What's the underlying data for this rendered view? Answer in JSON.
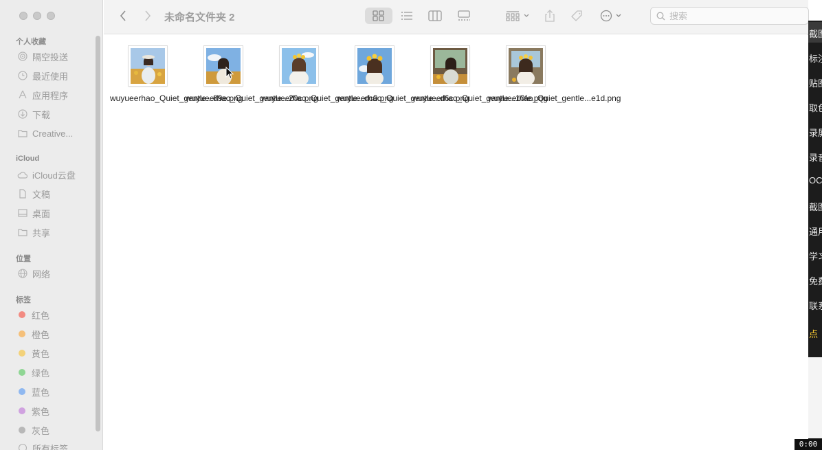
{
  "window": {
    "title": "未命名文件夹 2"
  },
  "sidebar": {
    "sections": {
      "favorites": "个人收藏",
      "icloud": "iCloud",
      "locations": "位置",
      "tags": "标签"
    },
    "favorites": [
      {
        "label": "隔空投送",
        "icon": "airdrop-icon"
      },
      {
        "label": "最近使用",
        "icon": "clock-icon"
      },
      {
        "label": "应用程序",
        "icon": "applications-icon"
      },
      {
        "label": "下载",
        "icon": "download-icon"
      },
      {
        "label": "Creative...",
        "icon": "folder-icon"
      }
    ],
    "icloud_items": [
      {
        "label": "iCloud云盘",
        "icon": "cloud-icon"
      },
      {
        "label": "文稿",
        "icon": "document-icon"
      },
      {
        "label": "桌面",
        "icon": "desktop-icon"
      },
      {
        "label": "共享",
        "icon": "shared-folder-icon"
      }
    ],
    "location_items": [
      {
        "label": "网络",
        "icon": "network-icon"
      }
    ],
    "tags": [
      {
        "label": "红色",
        "color": "#f28b82"
      },
      {
        "label": "橙色",
        "color": "#f5c07a"
      },
      {
        "label": "黄色",
        "color": "#f3d27a"
      },
      {
        "label": "绿色",
        "color": "#8fd694"
      },
      {
        "label": "蓝色",
        "color": "#8fb8f0"
      },
      {
        "label": "紫色",
        "color": "#d0a2e0"
      },
      {
        "label": "灰色",
        "color": "#b8b8b8"
      }
    ],
    "more_tags": "所有标签"
  },
  "toolbar": {
    "search_placeholder": "搜索"
  },
  "files": [
    {
      "name": "wuyueerhao_Quiet_gentle...89e.png"
    },
    {
      "name": "wuyueerhao_Quiet_gentle...20c.png"
    },
    {
      "name": "wuyueerhao_Quiet_gentle...dc0.png"
    },
    {
      "name": "wuyueerhao_Quiet_gentle...d6c.png"
    },
    {
      "name": "wuyueerhao_Quiet_gentle...10fe.png"
    },
    {
      "name": "wuyueerhao_Quiet_gentle...e1d.png"
    }
  ],
  "overlay_menu": {
    "items": [
      "截图",
      "标注",
      "贴图",
      "取色",
      "录屏",
      "录音",
      "OCR",
      "截图",
      "通用",
      "学习",
      "免费",
      "联系"
    ],
    "highlight": "点"
  },
  "clock": "0:00"
}
